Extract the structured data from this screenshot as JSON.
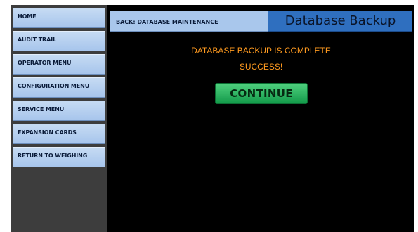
{
  "sidebar": {
    "items": [
      {
        "label": "HOME"
      },
      {
        "label": "AUDIT TRAIL"
      },
      {
        "label": "OPERATOR MENU"
      },
      {
        "label": "CONFIGURATION MENU"
      },
      {
        "label": "SERVICE MENU"
      },
      {
        "label": "EXPANSION CARDS"
      },
      {
        "label": "RETURN TO WEIGHING"
      }
    ]
  },
  "header": {
    "back_label": "BACK: DATABASE MAINTENANCE",
    "title": "Database Backup"
  },
  "main": {
    "message": "DATABASE BACKUP IS COMPLETE",
    "status": "SUCCESS!",
    "continue_label": "CONTINUE"
  },
  "colors": {
    "message_text": "#ff9a1f",
    "continue_button": "#139a4a",
    "title_bar": "#2f6fbf",
    "nav_button": "#a7c5ec"
  }
}
